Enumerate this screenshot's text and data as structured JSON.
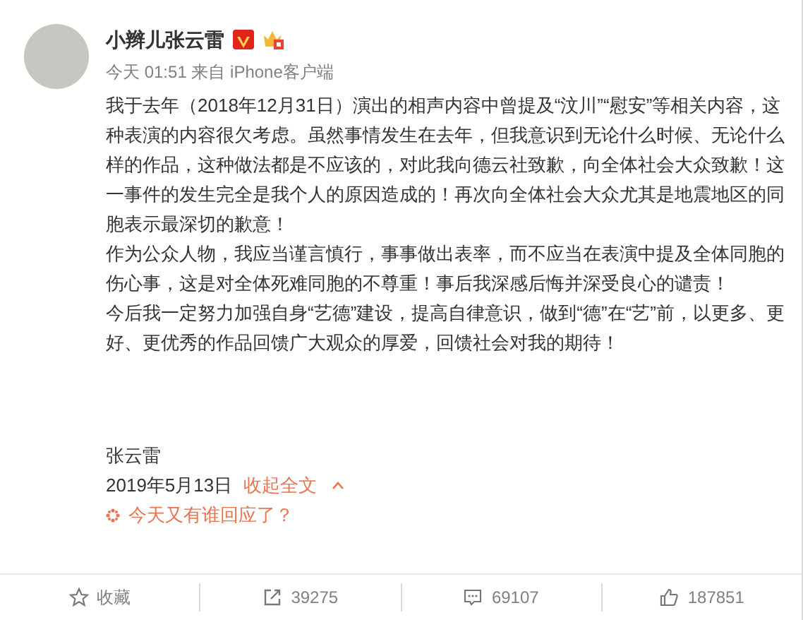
{
  "post": {
    "author": "小辫儿张云雷",
    "verified": true,
    "meta": "今天 01:51 来自 iPhone客户端",
    "paragraphs": [
      "我于去年（2018年12月31日）演出的相声内容中曾提及“汶川”“慰安”等相关内容，这种表演的内容很欠考虑。虽然事情发生在去年，但我意识到无论什么时候、无论什么样的作品，这种做法都是不应该的，对此我向德云社致歉，向全体社会大众致歉！这一事件的发生完全是我个人的原因造成的！再次向全体社会大众尤其是地震地区的同胞表示最深切的歉意！",
      "作为公众人物，我应当谨言慎行，事事做出表率，而不应当在表演中提及全体同胞的伤心事，这是对全体死难同胞的不尊重！事后我深感后悔并深受良心的谴责！",
      "今后我一定努力加强自身“艺德”建设，提高自律意识，做到“德”在“艺”前，以更多、更好、更优秀的作品回馈广大观众的厚爱，回馈社会对我的期待！"
    ],
    "signature": "张云雷",
    "date": "2019年5月13日",
    "collapse_link": "收起全文",
    "reply_prompt": "今天又有谁回应了？"
  },
  "actions": [
    {
      "kind": "favorite",
      "label": "收藏"
    },
    {
      "kind": "repost",
      "label": "39275"
    },
    {
      "kind": "comment",
      "label": "69107"
    },
    {
      "kind": "like",
      "label": "187851"
    }
  ]
}
